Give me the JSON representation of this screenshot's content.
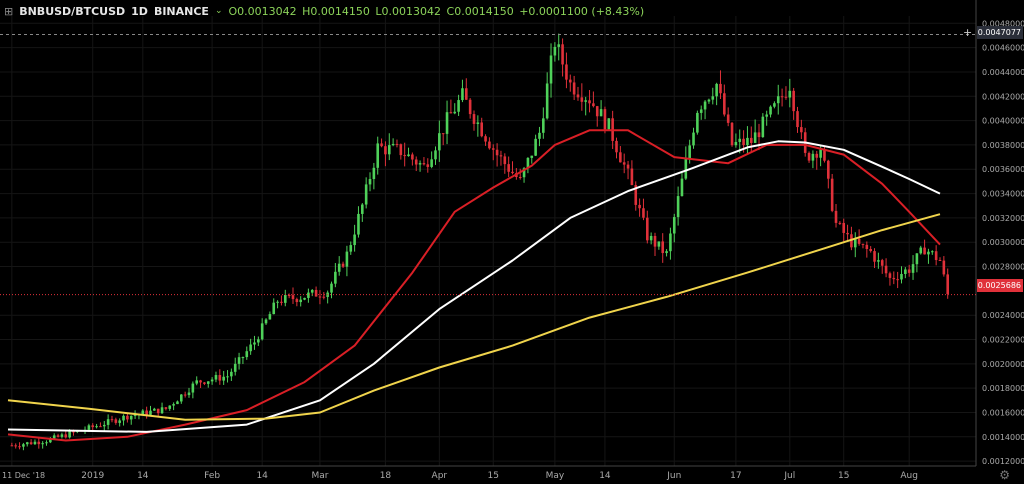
{
  "header": {
    "symbol": "BNBUSD/BTCUSD",
    "interval": "1D",
    "exchange": "BINANCE",
    "open": "O0.0013042",
    "high": "H0.0014150",
    "low": "L0.0013042",
    "close": "C0.0014150",
    "change": "+0.0001100 (+8.43%)"
  },
  "crosshair_label": "0.0047077",
  "last_price_label": "0.0025686",
  "colors": {
    "background": "#000000",
    "up_candle": "#4fd15a",
    "down_candle": "#e0313a",
    "ma_fast": "#d91f26",
    "ma_mid": "#ffffff",
    "ma_slow": "#f0d44c",
    "text": "#aaaaaa"
  },
  "chart_data": {
    "type": "candlestick",
    "y_axis": {
      "range": [
        0.00116,
        0.00486
      ],
      "ticks": [
        "0.0048000",
        "0.0046000",
        "0.0044000",
        "0.0042000",
        "0.0040000",
        "0.0038000",
        "0.0036000",
        "0.0034000",
        "0.0032000",
        "0.0030000",
        "0.0028000",
        "0.0024000",
        "0.0022000",
        "0.0020000",
        "0.0018000",
        "0.0016000",
        "0.0014000",
        "0.0012000"
      ]
    },
    "x_axis": {
      "start": "2018-12-10",
      "end": "2019-08-09",
      "date_labels": [
        {
          "date": "2018-12-11",
          "text": "11 Dec '18"
        },
        {
          "date": "2019-01-01",
          "text": "2019"
        },
        {
          "date": "2019-01-14",
          "text": "14"
        },
        {
          "date": "2019-02-01",
          "text": "Feb"
        },
        {
          "date": "2019-02-14",
          "text": "14"
        },
        {
          "date": "2019-03-01",
          "text": "Mar"
        },
        {
          "date": "2019-03-18",
          "text": "18"
        },
        {
          "date": "2019-04-01",
          "text": "Apr"
        },
        {
          "date": "2019-04-15",
          "text": "15"
        },
        {
          "date": "2019-05-01",
          "text": "May"
        },
        {
          "date": "2019-05-14",
          "text": "14"
        },
        {
          "date": "2019-06-01",
          "text": "Jun"
        },
        {
          "date": "2019-06-17",
          "text": "17"
        },
        {
          "date": "2019-07-01",
          "text": "Jul"
        },
        {
          "date": "2019-07-15",
          "text": "15"
        },
        {
          "date": "2019-08-01",
          "text": "Aug"
        }
      ]
    },
    "close_path": [
      [
        "2018-12-11",
        0.00133
      ],
      [
        "2018-12-20",
        0.00137
      ],
      [
        "2019-01-01",
        0.00148
      ],
      [
        "2019-01-10",
        0.00157
      ],
      [
        "2019-01-20",
        0.00163
      ],
      [
        "2019-01-28",
        0.00185
      ],
      [
        "2019-02-05",
        0.0019
      ],
      [
        "2019-02-12",
        0.00218
      ],
      [
        "2019-02-18",
        0.00252
      ],
      [
        "2019-02-24",
        0.00255
      ],
      [
        "2019-03-03",
        0.0026
      ],
      [
        "2019-03-08",
        0.0029
      ],
      [
        "2019-03-12",
        0.0033
      ],
      [
        "2019-03-16",
        0.00378
      ],
      [
        "2019-03-22",
        0.00375
      ],
      [
        "2019-03-28",
        0.00362
      ],
      [
        "2019-04-03",
        0.004
      ],
      [
        "2019-04-07",
        0.0042
      ],
      [
        "2019-04-11",
        0.00398
      ],
      [
        "2019-04-16",
        0.00372
      ],
      [
        "2019-04-22",
        0.0035
      ],
      [
        "2019-04-27",
        0.0039
      ],
      [
        "2019-05-01",
        0.00465
      ],
      [
        "2019-05-05",
        0.0043
      ],
      [
        "2019-05-10",
        0.00418
      ],
      [
        "2019-05-15",
        0.00395
      ],
      [
        "2019-05-20",
        0.00355
      ],
      [
        "2019-05-25",
        0.00305
      ],
      [
        "2019-05-30",
        0.0029
      ],
      [
        "2019-06-03",
        0.0035
      ],
      [
        "2019-06-07",
        0.0041
      ],
      [
        "2019-06-12",
        0.0043
      ],
      [
        "2019-06-16",
        0.0038
      ],
      [
        "2019-06-21",
        0.00383
      ],
      [
        "2019-06-27",
        0.0041
      ],
      [
        "2019-07-01",
        0.0043
      ],
      [
        "2019-07-05",
        0.0037
      ],
      [
        "2019-07-09",
        0.00378
      ],
      [
        "2019-07-13",
        0.00315
      ],
      [
        "2019-07-17",
        0.003
      ],
      [
        "2019-07-22",
        0.00292
      ],
      [
        "2019-07-27",
        0.0027
      ],
      [
        "2019-08-01",
        0.00278
      ],
      [
        "2019-08-05",
        0.00295
      ],
      [
        "2019-08-09",
        0.00285
      ],
      [
        "2019-08-11",
        0.00257
      ]
    ],
    "moving_averages": [
      {
        "color_key": "ma_fast",
        "points": [
          [
            "2018-12-10",
            0.00142
          ],
          [
            "2018-12-25",
            0.00137
          ],
          [
            "2019-01-10",
            0.0014
          ],
          [
            "2019-01-25",
            0.0015
          ],
          [
            "2019-02-10",
            0.00162
          ],
          [
            "2019-02-25",
            0.00185
          ],
          [
            "2019-03-10",
            0.00215
          ],
          [
            "2019-03-25",
            0.00275
          ],
          [
            "2019-04-05",
            0.00325
          ],
          [
            "2019-04-15",
            0.00345
          ],
          [
            "2019-04-25",
            0.00363
          ],
          [
            "2019-05-01",
            0.0038
          ],
          [
            "2019-05-10",
            0.00392
          ],
          [
            "2019-05-20",
            0.00392
          ],
          [
            "2019-06-01",
            0.0037
          ],
          [
            "2019-06-15",
            0.00365
          ],
          [
            "2019-06-25",
            0.0038
          ],
          [
            "2019-07-05",
            0.0038
          ],
          [
            "2019-07-15",
            0.00372
          ],
          [
            "2019-07-25",
            0.00348
          ],
          [
            "2019-08-01",
            0.00325
          ],
          [
            "2019-08-09",
            0.00298
          ]
        ]
      },
      {
        "color_key": "ma_mid",
        "points": [
          [
            "2018-12-10",
            0.00146
          ],
          [
            "2019-01-15",
            0.00144
          ],
          [
            "2019-02-10",
            0.0015
          ],
          [
            "2019-03-01",
            0.0017
          ],
          [
            "2019-03-15",
            0.002
          ],
          [
            "2019-04-01",
            0.00245
          ],
          [
            "2019-04-20",
            0.00285
          ],
          [
            "2019-05-05",
            0.0032
          ],
          [
            "2019-05-20",
            0.00342
          ],
          [
            "2019-06-05",
            0.0036
          ],
          [
            "2019-06-20",
            0.00378
          ],
          [
            "2019-06-28",
            0.00383
          ],
          [
            "2019-07-05",
            0.00382
          ],
          [
            "2019-07-15",
            0.00376
          ],
          [
            "2019-07-25",
            0.00362
          ],
          [
            "2019-08-01",
            0.00352
          ],
          [
            "2019-08-09",
            0.0034
          ]
        ]
      },
      {
        "color_key": "ma_slow",
        "points": [
          [
            "2018-12-10",
            0.0017
          ],
          [
            "2018-12-31",
            0.00163
          ],
          [
            "2019-01-25",
            0.00154
          ],
          [
            "2019-02-15",
            0.00155
          ],
          [
            "2019-03-01",
            0.0016
          ],
          [
            "2019-03-15",
            0.00178
          ],
          [
            "2019-04-01",
            0.00197
          ],
          [
            "2019-04-20",
            0.00215
          ],
          [
            "2019-05-10",
            0.00238
          ],
          [
            "2019-05-30",
            0.00255
          ],
          [
            "2019-06-20",
            0.00275
          ],
          [
            "2019-07-10",
            0.00295
          ],
          [
            "2019-07-25",
            0.0031
          ],
          [
            "2019-08-09",
            0.00323
          ]
        ]
      }
    ],
    "crosshair_value": 0.0047077,
    "last_price": 0.0025686
  }
}
